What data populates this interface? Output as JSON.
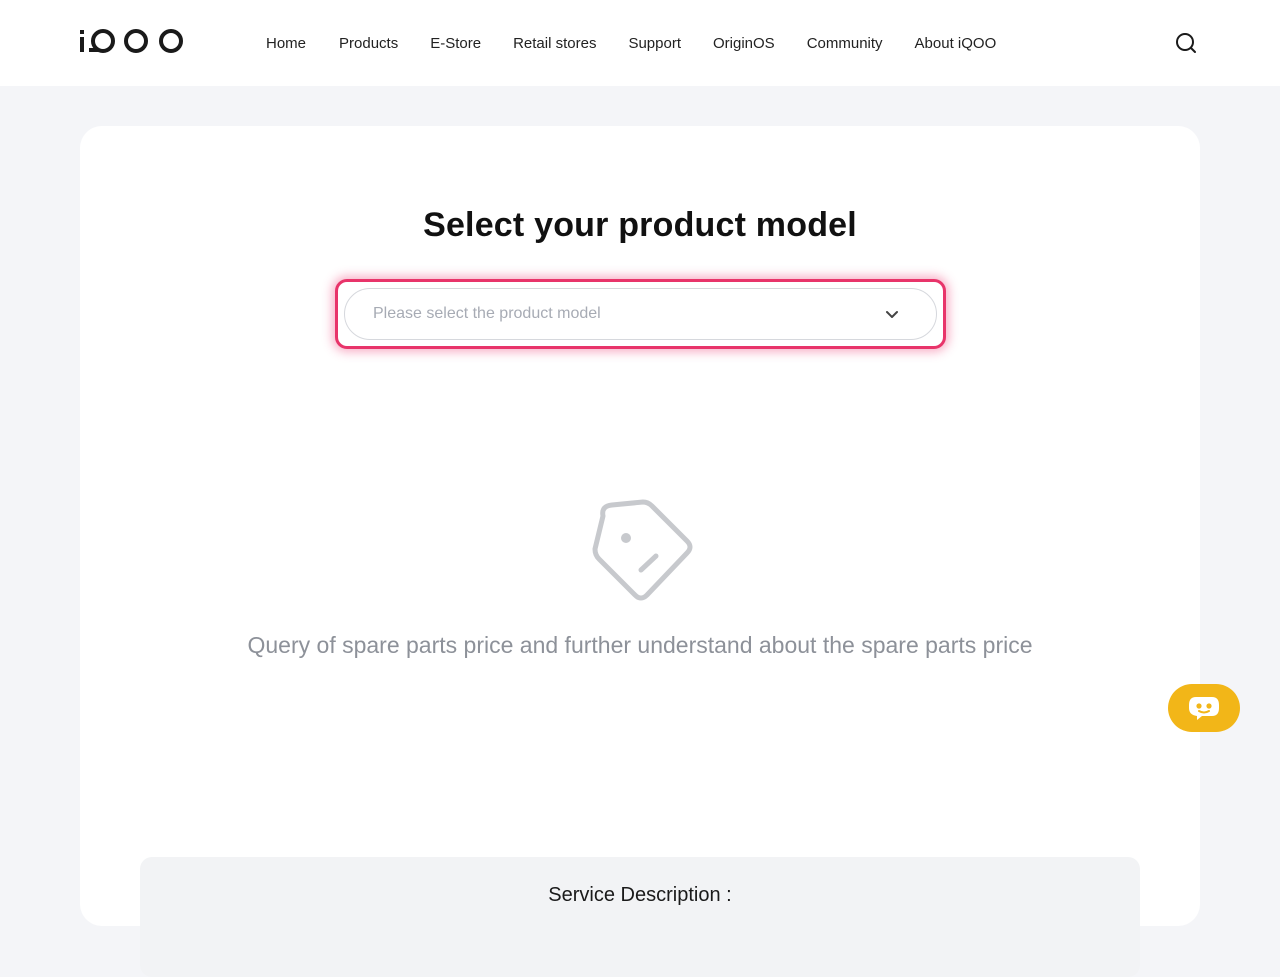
{
  "header": {
    "logo_text": "iQOO",
    "nav": [
      "Home",
      "Products",
      "E-Store",
      "Retail stores",
      "Support",
      "OriginOS",
      "Community",
      "About iQOO"
    ],
    "search_icon": "search-icon"
  },
  "main": {
    "title": "Select your product model",
    "select": {
      "placeholder": "Please select the product model",
      "icon": "chevron-down-icon"
    },
    "empty_state": {
      "icon": "price-tag-icon",
      "text": "Query of spare parts price and further understand about the spare parts price"
    },
    "service": {
      "title": "Service Description :"
    }
  },
  "chat": {
    "icon": "chatbot-icon"
  },
  "colors": {
    "highlight": "#e8346a",
    "chat_button": "#f2b618",
    "muted_text": "#8d9199"
  }
}
